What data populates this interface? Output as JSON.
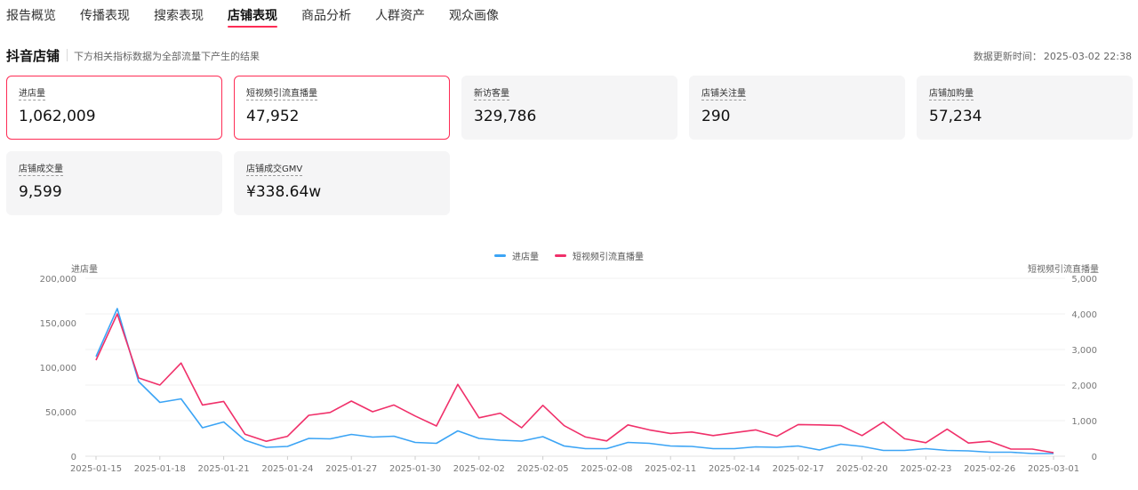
{
  "tabs": [
    "报告概览",
    "传播表现",
    "搜索表现",
    "店铺表现",
    "商品分析",
    "人群资产",
    "观众画像"
  ],
  "active_tab_index": 3,
  "section": {
    "title": "抖音店铺",
    "description": "下方相关指标数据为全部流量下产生的结果",
    "update_label": "数据更新时间：",
    "update_time": "2025-03-02 22:38"
  },
  "metrics": [
    {
      "label": "进店量",
      "value": "1,062,009",
      "selected": true
    },
    {
      "label": "短视频引流直播量",
      "value": "47,952",
      "selected": true
    },
    {
      "label": "新访客量",
      "value": "329,786",
      "selected": false
    },
    {
      "label": "店铺关注量",
      "value": "290",
      "selected": false
    },
    {
      "label": "店铺加购量",
      "value": "57,234",
      "selected": false
    },
    {
      "label": "店铺成交量",
      "value": "9,599",
      "selected": false
    },
    {
      "label": "店铺成交GMV",
      "value": "¥338.64w",
      "selected": false
    }
  ],
  "colors": {
    "accent": "#fe2c55",
    "series_blue": "#3ba4f5",
    "series_pink": "#f0306a"
  },
  "chart_data": {
    "type": "line",
    "legend_placement": "top-center",
    "grid": true,
    "left_axis_label": "进店量",
    "right_axis_label": "短视频引流直播量",
    "left_ylim": [
      0,
      200000
    ],
    "right_ylim": [
      0,
      5000
    ],
    "left_ticks": [
      "0",
      "50,000",
      "100,000",
      "150,000",
      "200,000"
    ],
    "right_ticks": [
      "0",
      "1,000",
      "2,000",
      "3,000",
      "4,000",
      "5,000"
    ],
    "x_tick_labels": [
      "2025-01-15",
      "2025-01-18",
      "2025-01-21",
      "2025-01-24",
      "2025-01-27",
      "2025-01-30",
      "2025-02-02",
      "2025-02-05",
      "2025-02-08",
      "2025-02-11",
      "2025-02-14",
      "2025-02-17",
      "2025-02-20",
      "2025-02-23",
      "2025-02-26",
      "2025-03-01"
    ],
    "x": [
      "2025-01-15",
      "2025-01-16",
      "2025-01-17",
      "2025-01-18",
      "2025-01-19",
      "2025-01-20",
      "2025-01-21",
      "2025-01-22",
      "2025-01-23",
      "2025-01-24",
      "2025-01-25",
      "2025-01-26",
      "2025-01-27",
      "2025-01-28",
      "2025-01-29",
      "2025-01-30",
      "2025-01-31",
      "2025-02-01",
      "2025-02-02",
      "2025-02-03",
      "2025-02-04",
      "2025-02-05",
      "2025-02-06",
      "2025-02-07",
      "2025-02-08",
      "2025-02-09",
      "2025-02-10",
      "2025-02-11",
      "2025-02-12",
      "2025-02-13",
      "2025-02-14",
      "2025-02-15",
      "2025-02-16",
      "2025-02-17",
      "2025-02-18",
      "2025-02-19",
      "2025-02-20",
      "2025-02-21",
      "2025-02-22",
      "2025-02-23",
      "2025-02-24",
      "2025-02-25",
      "2025-02-26",
      "2025-02-27",
      "2025-02-28",
      "2025-03-01"
    ],
    "series": [
      {
        "name": "进店量",
        "axis": "left",
        "values": [
          112000,
          166000,
          84000,
          60500,
          64500,
          32000,
          38500,
          18000,
          10000,
          11000,
          20000,
          19500,
          24500,
          21500,
          22500,
          15500,
          14500,
          28500,
          20000,
          18000,
          17000,
          22000,
          11500,
          8500,
          8500,
          15500,
          14500,
          11500,
          11000,
          8500,
          8500,
          10500,
          10000,
          11500,
          7000,
          13500,
          11000,
          6500,
          6500,
          8500,
          6500,
          6000,
          4500,
          4500,
          3000,
          3000
        ]
      },
      {
        "name": "短视频引流直播量",
        "axis": "right",
        "values": [
          2700,
          4000,
          2200,
          2000,
          2620,
          1440,
          1540,
          620,
          420,
          560,
          1150,
          1230,
          1550,
          1250,
          1440,
          1130,
          850,
          2020,
          1080,
          1210,
          800,
          1430,
          860,
          540,
          430,
          880,
          740,
          640,
          680,
          580,
          660,
          740,
          560,
          890,
          880,
          860,
          580,
          960,
          490,
          380,
          760,
          370,
          420,
          200,
          200,
          100
        ]
      }
    ]
  }
}
